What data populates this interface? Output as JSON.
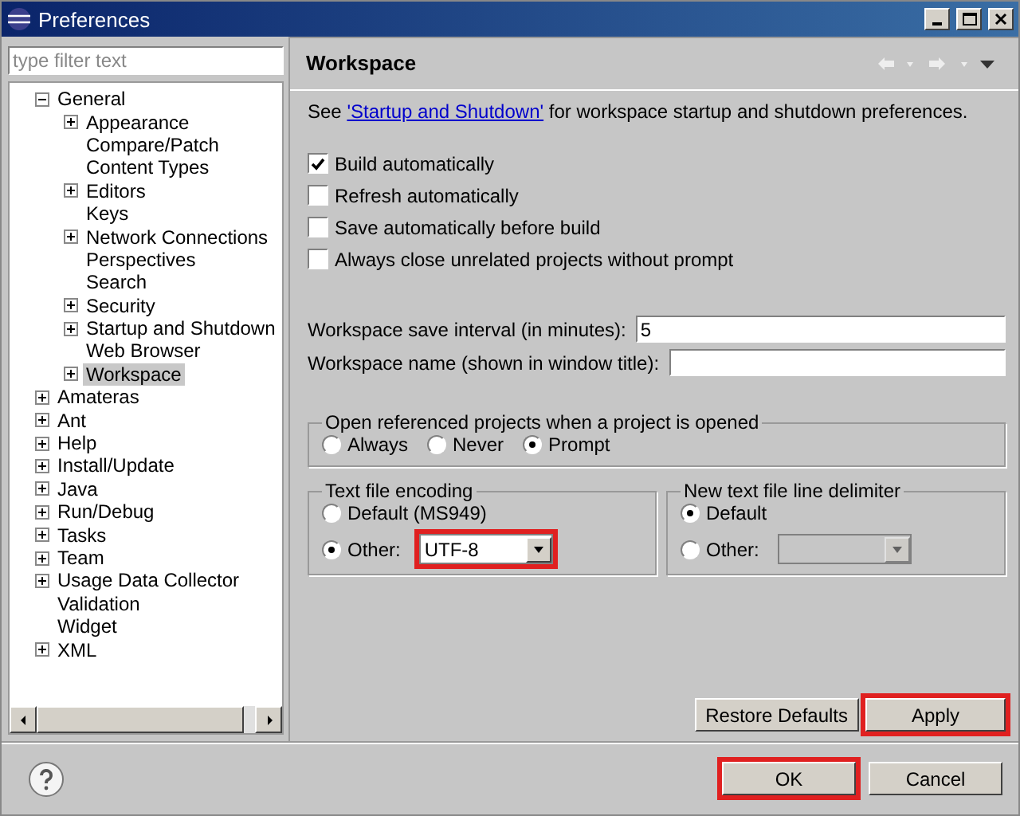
{
  "window": {
    "title": "Preferences"
  },
  "filter": {
    "placeholder": "type filter text"
  },
  "tree": [
    {
      "label": "General",
      "kind": "expanded",
      "selected": false,
      "children": [
        {
          "label": "Appearance",
          "kind": "collapsed",
          "selected": false
        },
        {
          "label": "Compare/Patch",
          "kind": "leaf",
          "selected": false
        },
        {
          "label": "Content Types",
          "kind": "leaf",
          "selected": false
        },
        {
          "label": "Editors",
          "kind": "collapsed",
          "selected": false
        },
        {
          "label": "Keys",
          "kind": "leaf",
          "selected": false
        },
        {
          "label": "Network Connections",
          "kind": "collapsed",
          "selected": false
        },
        {
          "label": "Perspectives",
          "kind": "leaf",
          "selected": false
        },
        {
          "label": "Search",
          "kind": "leaf",
          "selected": false
        },
        {
          "label": "Security",
          "kind": "collapsed",
          "selected": false
        },
        {
          "label": "Startup and Shutdown",
          "kind": "collapsed",
          "selected": false
        },
        {
          "label": "Web Browser",
          "kind": "leaf",
          "selected": false
        },
        {
          "label": "Workspace",
          "kind": "collapsed",
          "selected": true
        }
      ]
    },
    {
      "label": "Amateras",
      "kind": "collapsed",
      "selected": false
    },
    {
      "label": "Ant",
      "kind": "collapsed",
      "selected": false
    },
    {
      "label": "Help",
      "kind": "collapsed",
      "selected": false
    },
    {
      "label": "Install/Update",
      "kind": "collapsed",
      "selected": false
    },
    {
      "label": "Java",
      "kind": "collapsed",
      "selected": false
    },
    {
      "label": "Run/Debug",
      "kind": "collapsed",
      "selected": false
    },
    {
      "label": "Tasks",
      "kind": "collapsed",
      "selected": false
    },
    {
      "label": "Team",
      "kind": "collapsed",
      "selected": false
    },
    {
      "label": "Usage Data Collector",
      "kind": "collapsed",
      "selected": false
    },
    {
      "label": "Validation",
      "kind": "leaf",
      "selected": false
    },
    {
      "label": "Widget",
      "kind": "leaf",
      "selected": false
    },
    {
      "label": "XML",
      "kind": "collapsed",
      "selected": false
    }
  ],
  "page": {
    "title": "Workspace",
    "intro": {
      "before": "See",
      "link": "'Startup and Shutdown'",
      "after": "for workspace startup and shutdown preferences."
    },
    "checkboxes": [
      {
        "label": "Build automatically",
        "checked": true
      },
      {
        "label": "Refresh automatically",
        "checked": false
      },
      {
        "label": "Save automatically before build",
        "checked": false
      },
      {
        "label": "Always close unrelated projects without prompt",
        "checked": false
      }
    ],
    "fields": [
      {
        "label": "Workspace save interval (in minutes):",
        "value": "5"
      },
      {
        "label": "Workspace name (shown in window title):"
      }
    ],
    "open_referenced": {
      "title": "Open referenced projects when a project is opened",
      "options": [
        {
          "label": "Always",
          "selected": false
        },
        {
          "label": "Never",
          "selected": false
        },
        {
          "label": "Prompt",
          "selected": true
        }
      ]
    },
    "encoding": {
      "title": "Text file encoding",
      "default": {
        "label": "Default (MS949)",
        "selected": false
      },
      "other": {
        "label": "Other:",
        "selected": true,
        "value": "UTF-8",
        "disabled": false,
        "highlighted": true
      }
    },
    "delimiter": {
      "title": "New text file line delimiter",
      "default": {
        "label": "Default",
        "selected": true
      },
      "other": {
        "label": "Other:",
        "selected": false,
        "disabled": true,
        "highlighted": false
      }
    },
    "buttons": [
      {
        "label": "Restore Defaults",
        "highlighted": false
      },
      {
        "label": "Apply",
        "highlighted": true
      }
    ]
  },
  "dialog_buttons": [
    {
      "label": "OK",
      "highlighted": true
    },
    {
      "label": "Cancel",
      "highlighted": false
    }
  ]
}
